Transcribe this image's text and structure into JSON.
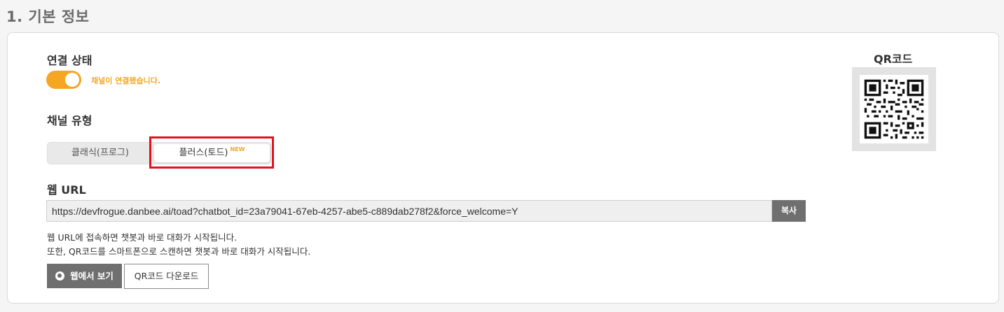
{
  "section": {
    "title": "1. 기본 정보"
  },
  "connection": {
    "label": "연결 상태",
    "status_text": "채널이 연결됐습니다.",
    "enabled": true,
    "accent_color": "#f5a623"
  },
  "channel_type": {
    "label": "채널 유형",
    "options": [
      {
        "label": "클래식(프로그)",
        "selected": false
      },
      {
        "label": "플러스(토드)",
        "badge": "NEW",
        "selected": true
      }
    ]
  },
  "web_url": {
    "label": "웹 URL",
    "value": "https://devfrogue.danbee.ai/toad?chatbot_id=23a79041-67eb-4257-abe5-c889dab278f2&force_welcome=Y",
    "copy_label": "복사",
    "description_lines": [
      "웹 URL에 접속하면 챗봇과 바로 대화가 시작됩니다.",
      "또한, QR코드를 스마트폰으로 스캔하면 챗봇과 바로 대화가 시작됩니다."
    ]
  },
  "actions": {
    "view_web_label": "웹에서 보기",
    "view_web_icon": "globe-icon",
    "download_qr_label": "QR코드 다운로드"
  },
  "qr": {
    "title": "QR코드"
  },
  "highlight_color": "#e0141e"
}
